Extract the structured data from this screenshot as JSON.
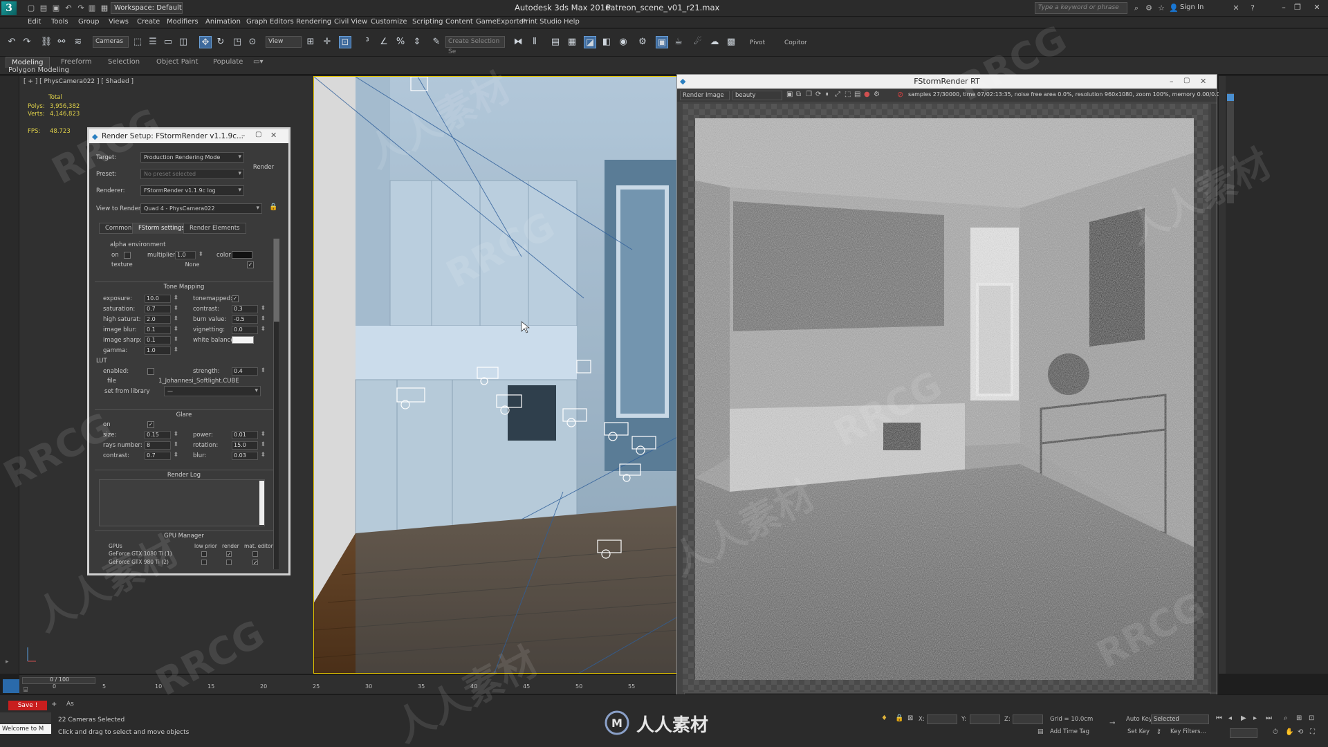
{
  "app": {
    "title": "Autodesk 3ds Max 2016",
    "file": "Patreon_scene_v01_r21.max",
    "workspace": "Workspace: Default",
    "search_placeholder": "Type a keyword or phrase",
    "sign_in": "Sign In",
    "logo_letter": "3"
  },
  "menus": [
    "Edit",
    "Tools",
    "Group",
    "Views",
    "Create",
    "Modifiers",
    "Animation",
    "Graph Editors",
    "Rendering",
    "Civil View",
    "Customize",
    "Scripting",
    "Content",
    "GameExporter",
    "Print Studio",
    "Help"
  ],
  "toolbar": {
    "selection_filter": "Cameras",
    "ref_coord": "View",
    "named_sel": "Create Selection Se",
    "pivot_label": "Pivot",
    "copitor_label": "Copitor"
  },
  "ribbon": {
    "tabs": [
      "Modeling",
      "Freeform",
      "Selection",
      "Object Paint",
      "Populate"
    ],
    "active_tab": "Modeling",
    "sub_label": "Polygon Modeling"
  },
  "viewport": {
    "label": "[ + ] [ PhysCamera022 ] [ Shaded ]",
    "stats_total": "Total",
    "polys_label": "Polys:",
    "polys_value": "3,956,382",
    "verts_label": "Verts:",
    "verts_value": "4,146,823",
    "fps_label": "FPS:",
    "fps_value": "48.723"
  },
  "render_setup": {
    "title": "Render Setup: FStormRender v1.1.9c...",
    "target_label": "Target:",
    "target_value": "Production Rendering Mode",
    "preset_label": "Preset:",
    "preset_value": "No preset selected",
    "renderer_label": "Renderer:",
    "renderer_value": "FStormRender v1.1.9c log",
    "view_label": "View to Render:",
    "view_value": "Quad 4 - PhysCamera022",
    "render_button": "Render",
    "tabs": [
      "Common",
      "FStorm settings",
      "Render Elements"
    ],
    "active_tab": "FStorm settings",
    "alpha_env": {
      "title": "alpha environment",
      "on_label": "on",
      "multiplier_label": "multiplier",
      "multiplier_value": "1.0",
      "color_label": "color",
      "texture_label": "texture",
      "texture_value": "None"
    },
    "tone_mapping": {
      "title": "Tone Mapping",
      "exposure_label": "exposure:",
      "exposure_value": "10.0",
      "saturation_label": "saturation:",
      "saturation_value": "0.7",
      "high_saturat_label": "high saturat:",
      "high_saturat_value": "2.0",
      "image_blur_label": "image blur:",
      "image_blur_value": "0.1",
      "image_sharp_label": "image sharp:",
      "image_sharp_value": "0.1",
      "gamma_label": "gamma:",
      "gamma_value": "1.0",
      "tonemapped_label": "tonemapped:",
      "contrast_label": "contrast:",
      "contrast_value": "0.3",
      "burn_label": "burn value:",
      "burn_value": "-0.5",
      "vignetting_label": "vignetting:",
      "vignetting_value": "0.0",
      "white_balance_label": "white balance:"
    },
    "lut": {
      "title": "LUT",
      "enabled_label": "enabled:",
      "strength_label": "strength:",
      "strength_value": "0.4",
      "file_label": "file",
      "file_value": "1_Johannesi_Softlight.CUBE",
      "library_label": "set from library",
      "library_value": "—"
    },
    "glare": {
      "title": "Glare",
      "on_label": "on",
      "size_label": "size:",
      "size_value": "0.15",
      "rays_label": "rays number:",
      "rays_value": "8",
      "contrast_label": "contrast:",
      "contrast_value": "0.7",
      "power_label": "power:",
      "power_value": "0.01",
      "rotation_label": "rotation:",
      "rotation_value": "15.0",
      "blur_label": "blur:",
      "blur_value": "0.03"
    },
    "render_log": {
      "title": "Render Log"
    },
    "gpu_manager": {
      "title": "GPU Manager",
      "col_gpus": "GPUs",
      "col_low": "low prior",
      "col_render": "render",
      "col_mat": "mat. editor",
      "gpu1": "GeForce GTX 1080 Ti (1)",
      "gpu2": "GeForce GTX 980 Ti (2)"
    }
  },
  "render_window": {
    "title": "FStormRender RT",
    "channel_dd": "Render Image",
    "element_dd": "beauty",
    "status": "samples 27/30000, time 07/02:13:35, noise free area 0.0%, resolution 960x1080, zoom 100%, memory 0.00/0.00Gb"
  },
  "timeline": {
    "frame": "0 / 100",
    "ticks": [
      "0",
      "5",
      "10",
      "15",
      "20",
      "25",
      "30",
      "35",
      "40",
      "45",
      "50",
      "55"
    ]
  },
  "status": {
    "save_button": "Save !",
    "welcome": "Welcome to M",
    "selection_info": "22 Cameras Selected",
    "prompt": "Click and drag to select and move objects",
    "x_label": "X:",
    "y_label": "Y:",
    "z_label": "Z:",
    "grid": "Grid = 10.0cm",
    "add_time_tag": "Add Time Tag",
    "auto_key": "Auto Key",
    "auto_key_dd": "Selected",
    "set_key": "Set Key",
    "key_filters": "Key Filters..."
  },
  "watermark": {
    "bottom_text": "人人素材",
    "diag_latin": "RRCG",
    "diag_cjk": "人人素材"
  },
  "colors": {
    "accent_blue": "#3e6a9c",
    "viewport_border": "#e1c200",
    "save_red": "#c81e1e"
  }
}
